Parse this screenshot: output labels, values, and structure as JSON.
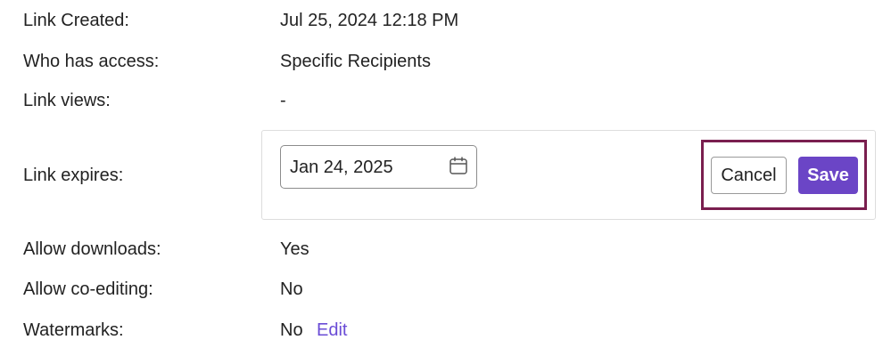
{
  "rows": {
    "created": {
      "label": "Link Created:",
      "value": "Jul 25, 2024 12:18 PM"
    },
    "access": {
      "label": "Who has access:",
      "value": "Specific Recipients"
    },
    "views": {
      "label": "Link views:",
      "value": "-"
    },
    "expires": {
      "label": "Link expires:",
      "date_value": "Jan 24, 2025"
    },
    "downloads": {
      "label": "Allow downloads:",
      "value": "Yes"
    },
    "coediting": {
      "label": "Allow co-editing:",
      "value": "No"
    },
    "watermarks": {
      "label": "Watermarks:",
      "value": "No",
      "edit_label": "Edit"
    }
  },
  "buttons": {
    "cancel_label": "Cancel",
    "save_label": "Save"
  },
  "icons": {
    "date_picker": "calendar-icon"
  },
  "colors": {
    "accent": "#6b45c6",
    "link": "#6a4cd6",
    "highlight": "#7a1f4f"
  }
}
